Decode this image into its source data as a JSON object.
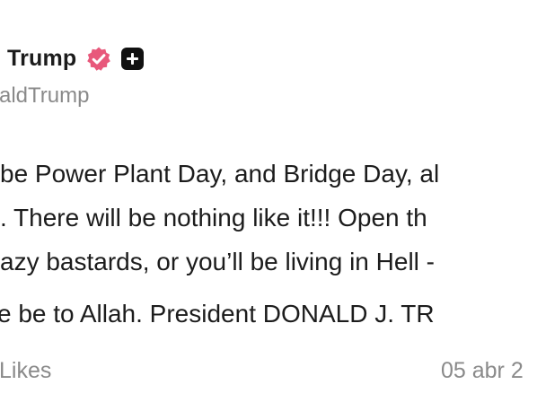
{
  "post": {
    "author_name": "Trump",
    "author_handle": "aldTrump",
    "body_lines": [
      "be Power Plant Day, and Bridge Day, al",
      ". There will be nothing like it!!! Open th",
      "azy bastards, or you’ll be living in Hell -",
      "e be to Allah. President DONALD J. TR"
    ],
    "likes_label": "Likes",
    "timestamp": "05 abr 2"
  },
  "icons": {
    "verified": "verified-badge-icon",
    "plus": "plus-icon"
  },
  "colors": {
    "text": "#1c1c1c",
    "muted": "#8a8a8a",
    "verified_badge": "#e8587b",
    "plus_background": "#111111",
    "background": "#ffffff"
  }
}
